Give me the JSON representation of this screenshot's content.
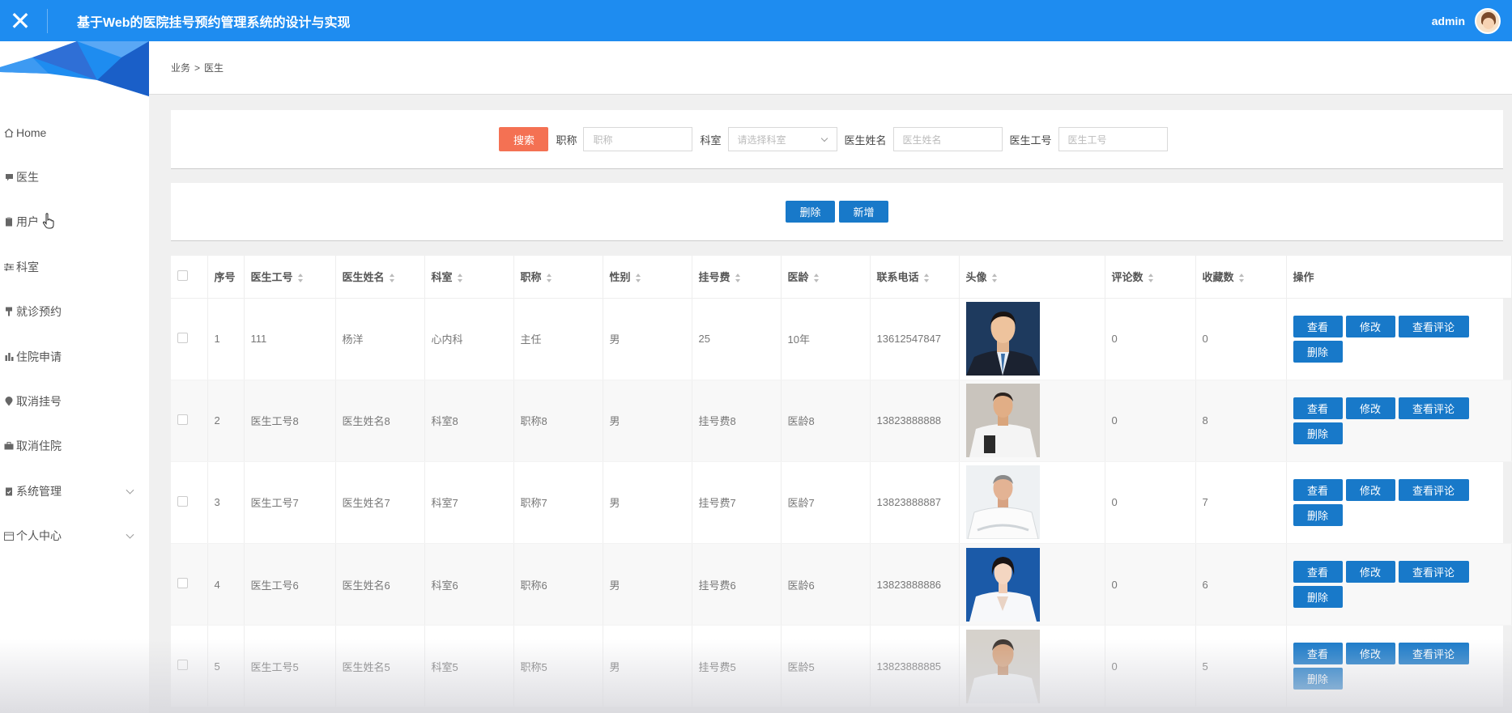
{
  "header": {
    "title": "基于Web的医院挂号预约管理系统的设计与实现",
    "username": "admin",
    "bg_color": "#1e8cf0"
  },
  "sidebar": {
    "items": [
      {
        "label": "Home",
        "icon": "home-icon"
      },
      {
        "label": "医生",
        "icon": "chat-icon"
      },
      {
        "label": "用户",
        "icon": "clipboard-icon"
      },
      {
        "label": "科室",
        "icon": "sliders-icon"
      },
      {
        "label": "就诊预约",
        "icon": "pin-icon"
      },
      {
        "label": "住院申请",
        "icon": "bar-chart-icon"
      },
      {
        "label": "取消挂号",
        "icon": "location-icon"
      },
      {
        "label": "取消住院",
        "icon": "briefcase-icon"
      },
      {
        "label": "系统管理",
        "icon": "clipboard-check-icon"
      },
      {
        "label": "个人中心",
        "icon": "calendar-icon"
      }
    ]
  },
  "breadcrumb": {
    "parent": "业务",
    "separator": ">",
    "current": "医生"
  },
  "search": {
    "button": "搜索",
    "title_label": "职称",
    "title_placeholder": "职称",
    "dept_label": "科室",
    "dept_placeholder": "请选择科室",
    "name_label": "医生姓名",
    "name_placeholder": "医生姓名",
    "id_label": "医生工号",
    "id_placeholder": "医生工号",
    "button_color": "#f47153"
  },
  "actions": {
    "delete": "删除",
    "add": "新增",
    "button_color": "#1879c9"
  },
  "table": {
    "columns": [
      "序号",
      "医生工号",
      "医生姓名",
      "科室",
      "职称",
      "性别",
      "挂号费",
      "医龄",
      "联系电话",
      "头像",
      "评论数",
      "收藏数",
      "操作"
    ],
    "row_buttons": {
      "view": "查看",
      "edit": "修改",
      "comments": "查看评论",
      "delete": "删除"
    },
    "rows": [
      {
        "no": "1",
        "doctor_id": "111",
        "name": "杨洋",
        "dept": "心内科",
        "title": "主任",
        "gender": "男",
        "fee": "25",
        "years": "10年",
        "phone": "13612547847",
        "comments": "0",
        "favorites": "0"
      },
      {
        "no": "2",
        "doctor_id": "医生工号8",
        "name": "医生姓名8",
        "dept": "科室8",
        "title": "职称8",
        "gender": "男",
        "fee": "挂号费8",
        "years": "医龄8",
        "phone": "13823888888",
        "comments": "0",
        "favorites": "8"
      },
      {
        "no": "3",
        "doctor_id": "医生工号7",
        "name": "医生姓名7",
        "dept": "科室7",
        "title": "职称7",
        "gender": "男",
        "fee": "挂号费7",
        "years": "医龄7",
        "phone": "13823888887",
        "comments": "0",
        "favorites": "7"
      },
      {
        "no": "4",
        "doctor_id": "医生工号6",
        "name": "医生姓名6",
        "dept": "科室6",
        "title": "职称6",
        "gender": "男",
        "fee": "挂号费6",
        "years": "医龄6",
        "phone": "13823888886",
        "comments": "0",
        "favorites": "6"
      },
      {
        "no": "5",
        "doctor_id": "医生工号5",
        "name": "医生姓名5",
        "dept": "科室5",
        "title": "职称5",
        "gender": "男",
        "fee": "挂号费5",
        "years": "医龄5",
        "phone": "13823888885",
        "comments": "0",
        "favorites": "5"
      }
    ]
  }
}
